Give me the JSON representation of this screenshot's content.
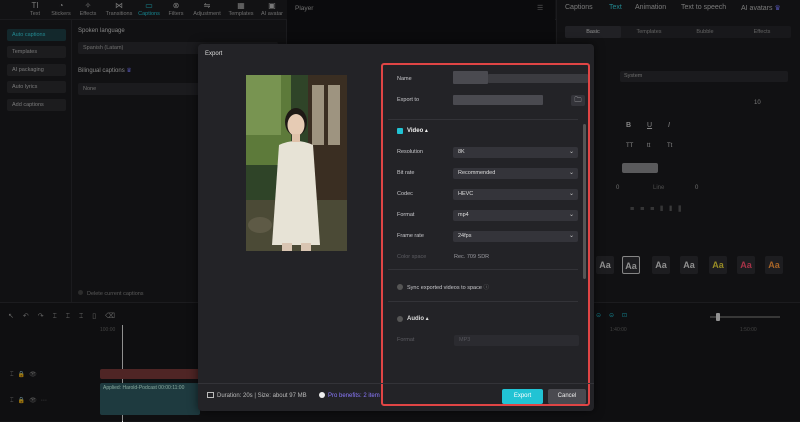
{
  "toolbar": {
    "items": [
      {
        "label": "Text",
        "icon": "text-icon"
      },
      {
        "label": "Stickers",
        "icon": "clock-icon"
      },
      {
        "label": "Effects",
        "icon": "sparkle-icon"
      },
      {
        "label": "Transitions",
        "icon": "bowtie-icon"
      },
      {
        "label": "Captions",
        "icon": "captions-icon"
      },
      {
        "label": "Filters",
        "icon": "filters-icon"
      },
      {
        "label": "Adjustment",
        "icon": "sliders-icon"
      },
      {
        "label": "Templates",
        "icon": "templates-icon"
      },
      {
        "label": "AI avatar",
        "icon": "avatar-icon"
      }
    ],
    "active": "Captions"
  },
  "leftnav": {
    "items": [
      "Auto captions",
      "Templates",
      "AI packaging",
      "Auto lyrics",
      "Add captions"
    ]
  },
  "captions_panel": {
    "spoken_language_label": "Spoken language",
    "spoken_language_value": "Spanish (Latam)",
    "bilingual_label": "Bilingual captions",
    "bilingual_value": "None",
    "delete_label": "Delete current captions"
  },
  "player": {
    "title": "Player"
  },
  "right_panel": {
    "tabs": [
      "Captions",
      "Text",
      "Animation",
      "Text to speech",
      "AI avatars"
    ],
    "active_tab": "Text",
    "sub_tabs": [
      "Basic",
      "Templates",
      "Bubble",
      "Effects"
    ],
    "font_value": "System",
    "font_size": "10",
    "format_buttons": [
      "B",
      "U",
      "I"
    ],
    "case_buttons": [
      "TT",
      "tt",
      "Tt"
    ],
    "spacing_label": "Line",
    "spacing_value": "0",
    "spacing_left": "0",
    "presets": [
      "Aa",
      "Aa",
      "Aa",
      "Aa",
      "Aa",
      "Aa",
      "Aa"
    ]
  },
  "dialog": {
    "title": "Export",
    "name_label": "Name",
    "export_to_label": "Export to",
    "video_label": "Video",
    "video_rows": [
      {
        "label": "Resolution",
        "value": "8K"
      },
      {
        "label": "Bit rate",
        "value": "Recommended"
      },
      {
        "label": "Codec",
        "value": "HEVC"
      },
      {
        "label": "Format",
        "value": "mp4"
      },
      {
        "label": "Frame rate",
        "value": "24fps"
      }
    ],
    "color_space_label": "Color space",
    "color_space_value": "Rec. 709 SDR",
    "sync_label": "Sync exported videos to space",
    "audio_label": "Audio",
    "audio_format_label": "Format",
    "audio_format_value": "MP3",
    "footer_info": "Duration: 20s | Size: about 97 MB",
    "pro_label": "Pro benefits: 2 item",
    "export_button": "Export",
    "cancel_button": "Cancel",
    "accent": "#21c3d4",
    "highlight": "#e04545"
  },
  "timeline": {
    "clip_label": "Applied: Harold-Podcast  00:00:11:00",
    "ruler_left": "100:00",
    "ruler_marks": [
      "1:40:00",
      "1:50:00"
    ]
  }
}
